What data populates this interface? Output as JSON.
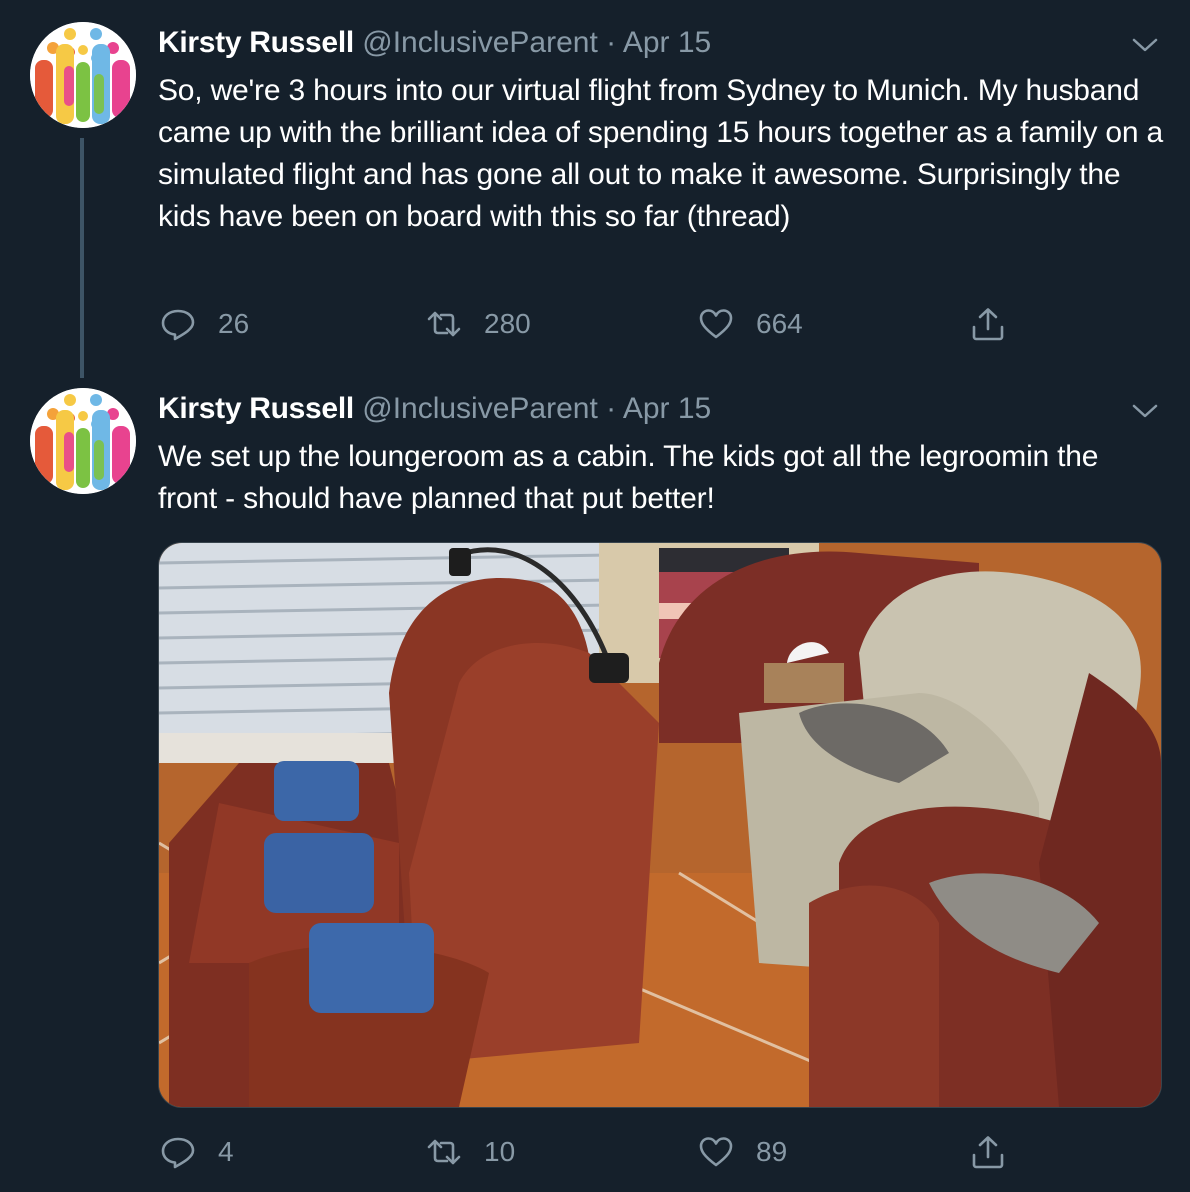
{
  "tweets": [
    {
      "author_name": "Kirsty Russell",
      "handle": "@InclusiveParent",
      "separator": "·",
      "date": "Apr 15",
      "text": "So, we're 3 hours into our virtual flight from Sydney to Munich. My husband came up with the brilliant idea of spending 15 hours together as a family on a simulated flight and has gone all out to make it awesome. Surprisingly the kids have been on board with this so far (thread)",
      "replies": "26",
      "retweets": "280",
      "likes": "664"
    },
    {
      "author_name": "Kirsty Russell",
      "handle": "@InclusiveParent",
      "separator": "·",
      "date": "Apr 15",
      "text": "We set up the loungeroom as a cabin. The kids got all the legroomin the front - should have planned that put better!",
      "replies": "4",
      "retweets": "10",
      "likes": "89"
    }
  ],
  "icons": {
    "reply": "reply-icon",
    "retweet": "retweet-icon",
    "like": "heart-icon",
    "share": "share-icon",
    "more": "chevron-down-icon"
  },
  "colors": {
    "background": "#15202b",
    "secondary_text": "#8899a6",
    "primary_text": "#ffffff",
    "thread_line": "#3d5466"
  }
}
